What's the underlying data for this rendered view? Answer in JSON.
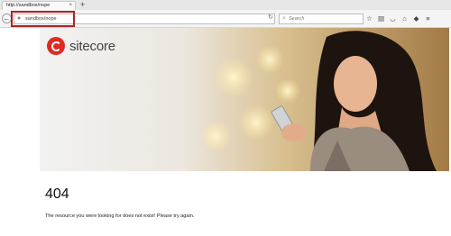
{
  "browser": {
    "tab": {
      "title": "http://sandbox/nope",
      "close_label": "×"
    },
    "new_tab_label": "+",
    "back_label": "←",
    "url": "sandbox/nope",
    "search_placeholder": "Search",
    "toolbar_icons": [
      "star-icon",
      "reading-list-icon",
      "pocket-icon",
      "home-icon",
      "extension-icon",
      "menu-icon"
    ]
  },
  "hero": {
    "logo_text": "sitecore",
    "logo_color": "#e02a20"
  },
  "content": {
    "error_code": "404",
    "message": "The resource you were looking for does not exist! Please try again."
  }
}
